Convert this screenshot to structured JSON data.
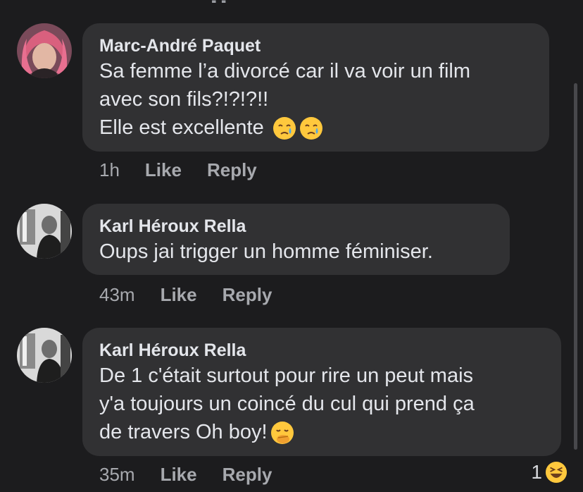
{
  "comments": [
    {
      "author": "Marc-André Paquet",
      "lines": [
        "Sa femme l’a divorcé car il va voir un film",
        "avec son fils?!?!?!!",
        "Elle est excellente"
      ],
      "time": "1h",
      "like": "Like",
      "reply": "Reply",
      "emojis": [
        "crying-face-icon",
        "crying-face-icon"
      ]
    },
    {
      "author": "Karl Héroux Rella",
      "lines": [
        "Oups jai trigger un homme féminiser."
      ],
      "time": "43m",
      "like": "Like",
      "reply": "Reply"
    },
    {
      "author": "Karl Héroux Rella",
      "lines": [
        "De 1 c'était surtout pour rire un peut mais",
        "y'a toujours un coincé du cul qui prend ça",
        "de travers Oh boy!"
      ],
      "time": "35m",
      "like": "Like",
      "reply": "Reply",
      "emojis": [
        "hand-over-mouth-icon"
      ],
      "reaction_count": "1",
      "reaction_icon": "laughing-face-icon"
    }
  ]
}
